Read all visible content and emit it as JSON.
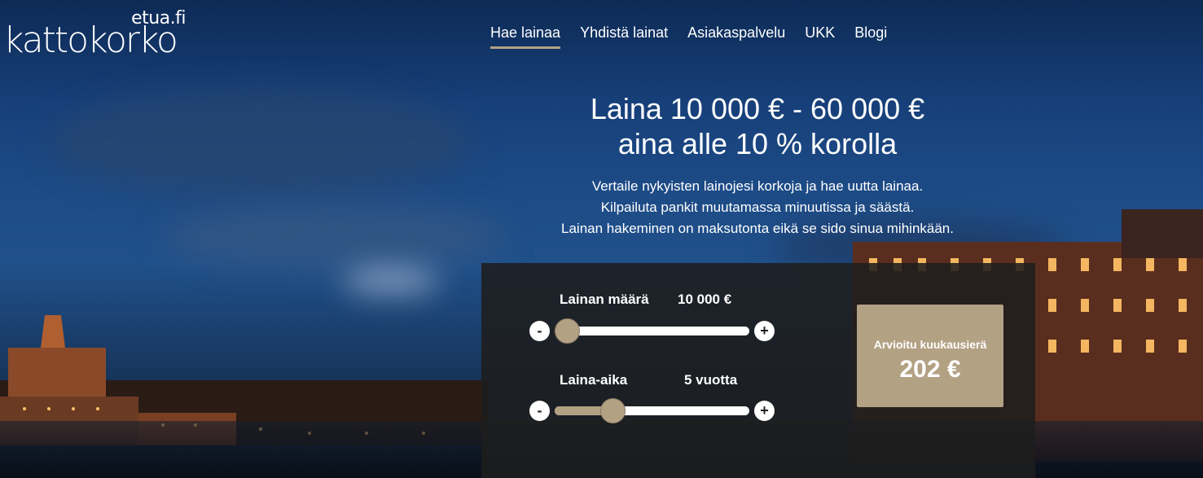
{
  "logo": {
    "sub": "etua.fi",
    "main": "kattokorko"
  },
  "nav": {
    "items": [
      "Hae lainaa",
      "Yhdistä lainat",
      "Asiakaspalvelu",
      "UKK",
      "Blogi"
    ]
  },
  "hero": {
    "title_line1": "Laina 10 000 € - 60 000 €",
    "title_line2": "aina alle 10 % korolla",
    "desc_line1": "Vertaile nykyisten lainojesi korkoja ja hae uutta lainaa.",
    "desc_line2": "Kilpailuta pankit muutamassa minuutissa ja säästä.",
    "desc_line3": "Lainan hakeminen on maksutonta eikä se sido sinua mihinkään."
  },
  "calculator": {
    "amount": {
      "label": "Lainan määrä",
      "value": "10 000 €",
      "minus": "-",
      "plus": "+",
      "level": 0.0
    },
    "term": {
      "label": "Laina-aika",
      "value": "5 vuotta",
      "minus": "-",
      "plus": "+",
      "level": 0.27
    },
    "result": {
      "label": "Arvioitu kuukausierä",
      "value": "202 €"
    }
  },
  "colors": {
    "accent": "#b3a184",
    "panel": "#1e1e1e"
  }
}
